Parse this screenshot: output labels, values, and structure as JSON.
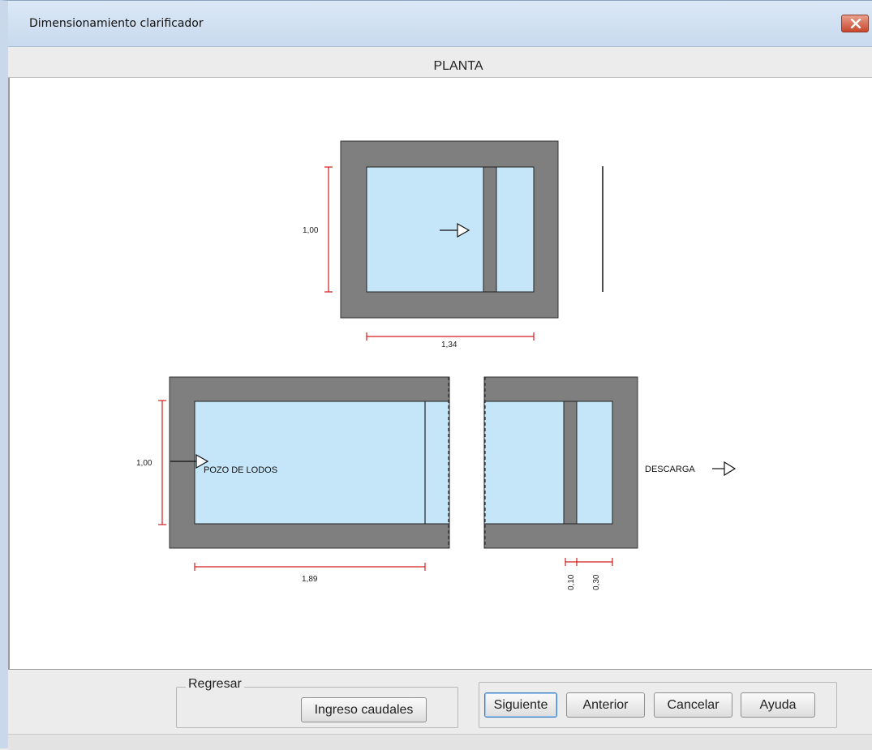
{
  "window": {
    "title": "Dimensionamiento clarificador"
  },
  "header": {
    "title": "PLANTA"
  },
  "drawing": {
    "top_view": {
      "height_label": "1,00",
      "width_label": "1,34"
    },
    "bottom_view": {
      "height_label": "1,00",
      "width_label": "1,89",
      "inlet_label": "POZO DE LODOS",
      "outlet_label": "DESCARGA",
      "baffle_label": "0,10",
      "outlet_zone_label": "0,30"
    },
    "colors": {
      "wall": "#7f7f7f",
      "water": "#c5e5f8",
      "dimension": "#d21c1c"
    }
  },
  "footer": {
    "back_group_label": "Regresar",
    "back_button": "Ingreso caudales",
    "next_button": "Siguiente",
    "previous_button": "Anterior",
    "cancel_button": "Cancelar",
    "help_button": "Ayuda"
  }
}
